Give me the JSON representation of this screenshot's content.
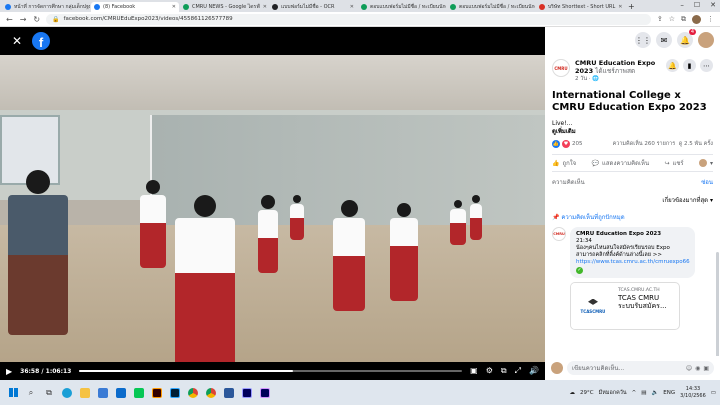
{
  "browser": {
    "tabs": [
      {
        "label": "หน้าที่ การจัดการศึกษา กลุ่มเด็กปฐมวัย",
        "color": "#1877f2",
        "active": false
      },
      {
        "label": "(8) Facebook",
        "color": "#1877f2",
        "active": true
      },
      {
        "label": "CMRU NEWS - Google ไดรฟ์",
        "color": "#0f9d58",
        "active": false
      },
      {
        "label": "แบบฟอร์มไม่มีชื่อ - OCR",
        "color": "#202124",
        "active": false
      },
      {
        "label": "ตอบแบบฟอร์มไม่มีชื่อ / ทะเบียนนักศึกษา",
        "color": "#0f9d58",
        "active": false
      },
      {
        "label": "ตอบแบบฟอร์มไม่มีชื่อ / ทะเบียนนักศึกษา",
        "color": "#0f9d58",
        "active": false
      },
      {
        "label": "บริษัท Shorttext - Short URL",
        "color": "#d93025",
        "active": false
      }
    ],
    "url": "facebook.com/CMRUEduExpo2023/videos/455861126577789"
  },
  "video": {
    "current_time": "36:58",
    "duration": "1:06:13",
    "progress": 0.558
  },
  "panel": {
    "page_name": "CMRU Education Expo 2023",
    "page_name_suffix": " ได้แชร์ภาพสด",
    "post_meta": "2 วัน · 🌐",
    "title": "International College x CMRU Education Expo 2023",
    "text": "Live!...",
    "see_more": "ดูเพิ่มเติม",
    "reaction_count": "205",
    "comments_count": "ความคิดเห็น 260 รายการ",
    "views": "ดู 2.5 พัน ครั้ง",
    "like_label": "ถูกใจ",
    "comment_label": "แสดงความคิดเห็น",
    "share_label": "แชร์",
    "comments_header": "ความคิดเห็น",
    "hide_label": "ซ่อน",
    "sort_label": "เกี่ยวข้องมากที่สุด",
    "pinned_label": "ความคิดเห็นที่ถูกปักหมุด",
    "pinned_comment": {
      "author": "CMRU Education Expo 2023",
      "time": "21:34",
      "text": "น้องๆคนไหนสนใจสมัครเรียนรอบ Expo สามารถคลิกที่ลิ้งค์ด้านล่างนี้เลย >>",
      "link": "https://www.tcas.cmru.ac.th/cmruexpo66"
    },
    "link_card": {
      "domain": "TCAS.CMRU.AC.TH",
      "title": "TCAS CMRU ระบบรับสมัคร...",
      "thumb_label": "TCASCMRU"
    },
    "composer_placeholder": "เขียนความคิดเห็น...",
    "notification_count": "4"
  },
  "taskbar": {
    "weather": "29°C",
    "weather_label": "มีหมอกควัน",
    "lang": "ENG",
    "time": "14:33",
    "date": "3/10/2566"
  },
  "icons": {
    "close": "close-icon",
    "facebook": "facebook-logo-icon",
    "menu": "grid-menu-icon",
    "messenger": "messenger-icon",
    "bell": "bell-icon"
  }
}
